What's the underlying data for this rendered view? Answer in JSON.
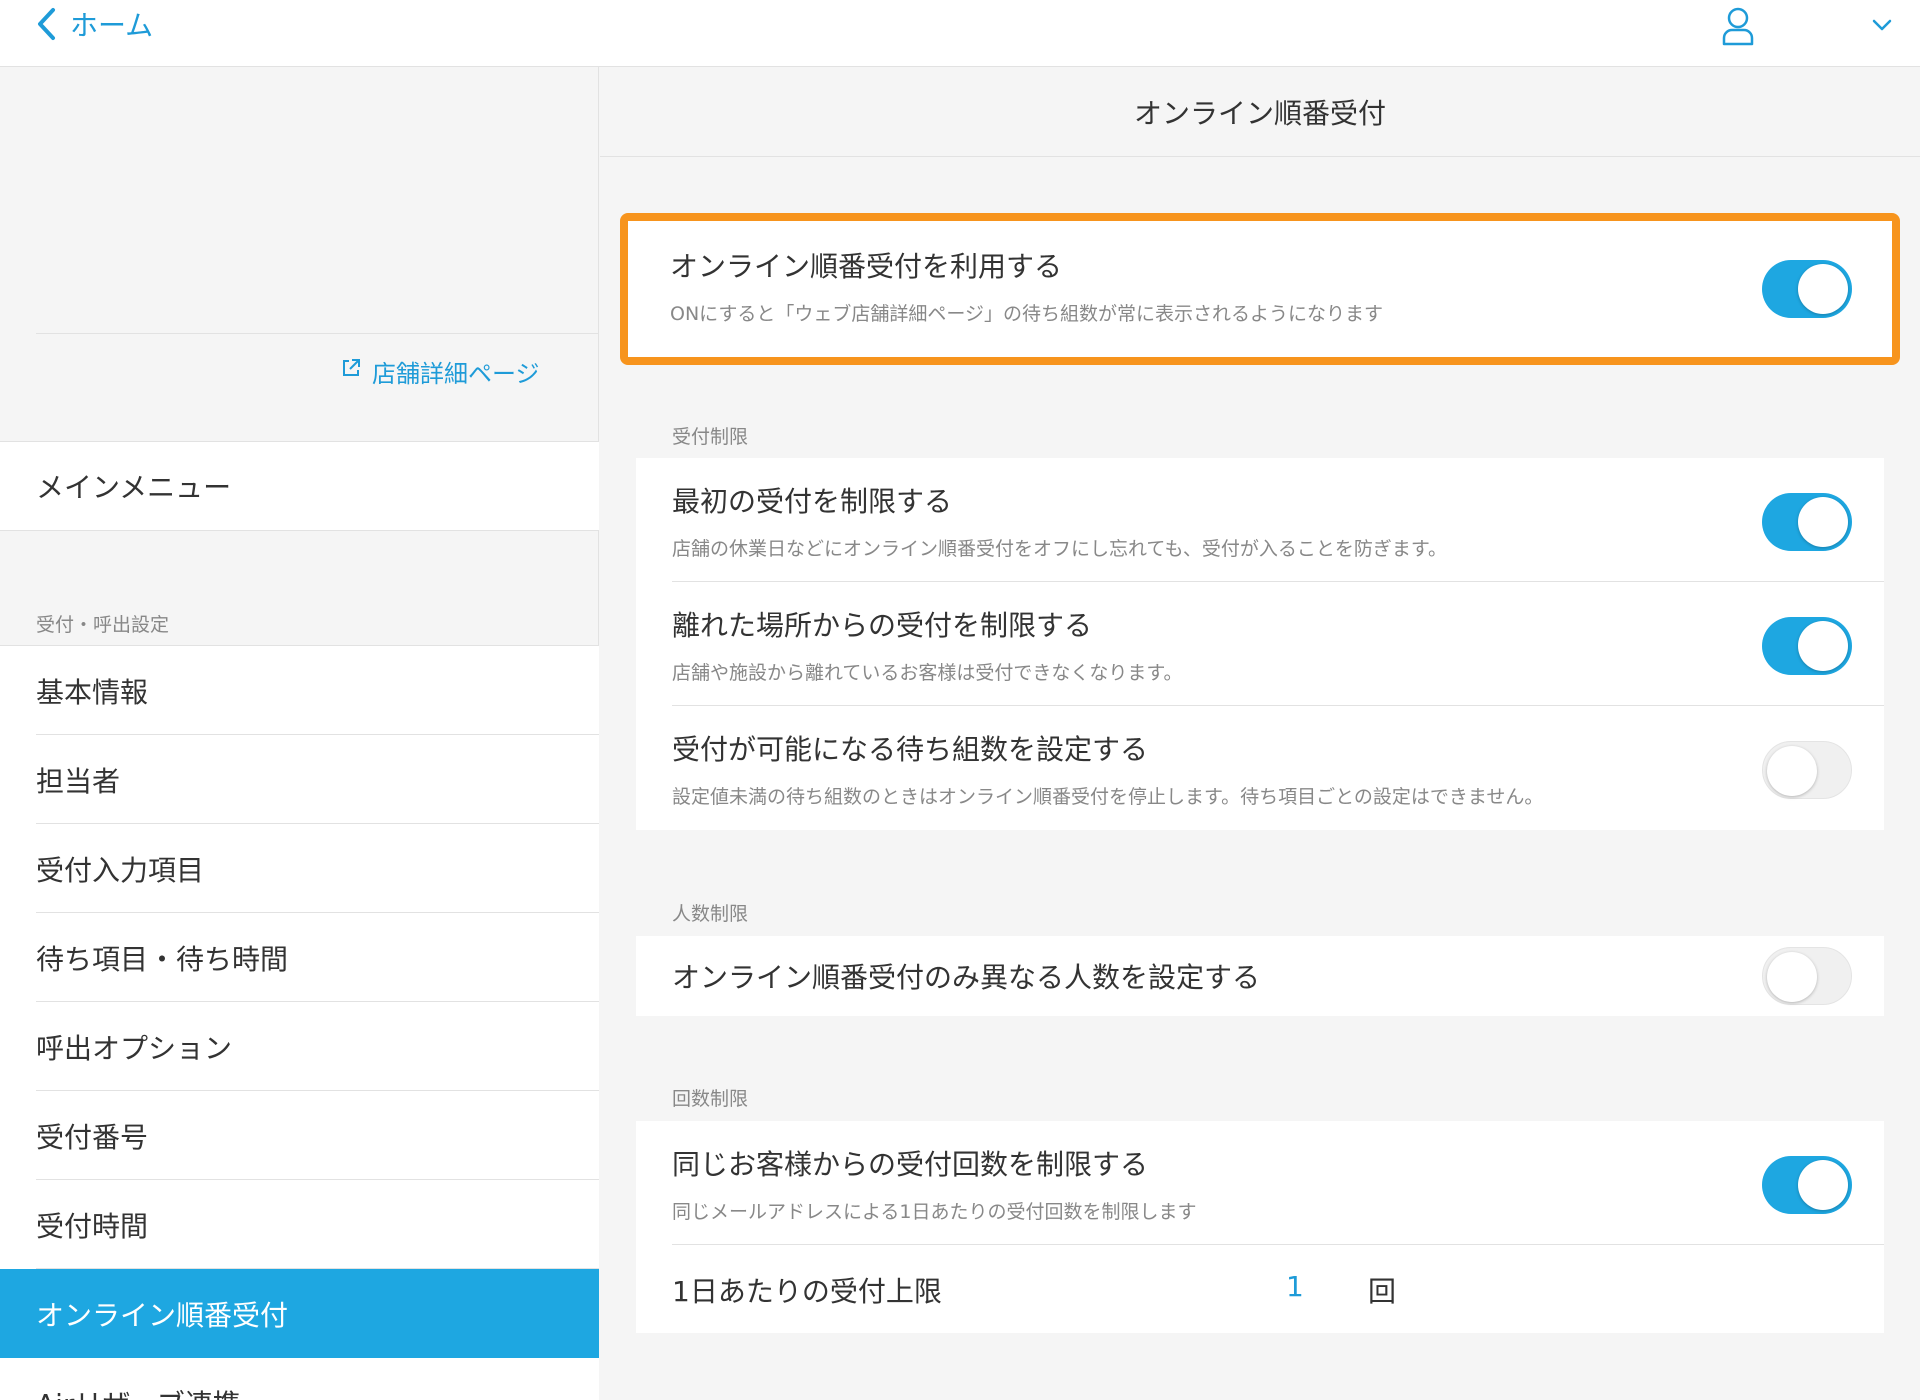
{
  "header": {
    "back_label": "ホーム"
  },
  "sidebar": {
    "store_link": "店舗詳細ページ",
    "main_menu": "メインメニュー",
    "section_label": "受付・呼出設定",
    "items": [
      {
        "label": "基本情報"
      },
      {
        "label": "担当者"
      },
      {
        "label": "受付入力項目"
      },
      {
        "label": "待ち項目・待ち時間"
      },
      {
        "label": "呼出オプション"
      },
      {
        "label": "受付番号"
      },
      {
        "label": "受付時間"
      },
      {
        "label": "オンライン順番受付",
        "active": true
      },
      {
        "label": "Airリザーブ連携"
      }
    ]
  },
  "main": {
    "title": "オンライン順番受付",
    "primary": {
      "title": "オンライン順番受付を利用する",
      "desc": "ONにすると「ウェブ店舗詳細ページ」の待ち組数が常に表示されるようになります",
      "on": true
    },
    "reception_limit": {
      "label": "受付制限",
      "rows": [
        {
          "title": "最初の受付を制限する",
          "desc": "店舗の休業日などにオンライン順番受付をオフにし忘れても、受付が入ることを防ぎます。",
          "on": true
        },
        {
          "title": "離れた場所からの受付を制限する",
          "desc": "店舗や施設から離れているお客様は受付できなくなります。",
          "on": true
        },
        {
          "title": "受付が可能になる待ち組数を設定する",
          "desc": "設定値未満の待ち組数のときはオンライン順番受付を停止します。待ち項目ごとの設定はできません。",
          "on": false
        }
      ]
    },
    "people_limit": {
      "label": "人数制限",
      "row": {
        "title": "オンライン順番受付のみ異なる人数を設定する",
        "on": false
      }
    },
    "count_limit": {
      "label": "回数制限",
      "row": {
        "title": "同じお客様からの受付回数を制限する",
        "desc": "同じメールアドレスによる1日あたりの受付回数を制限します",
        "on": true
      },
      "per_day": {
        "label": "1日あたりの受付上限",
        "value": "1",
        "unit": "回"
      }
    }
  },
  "colors": {
    "accent": "#1ea7e1",
    "link": "#1e9bd8",
    "highlight": "#f7941d"
  }
}
